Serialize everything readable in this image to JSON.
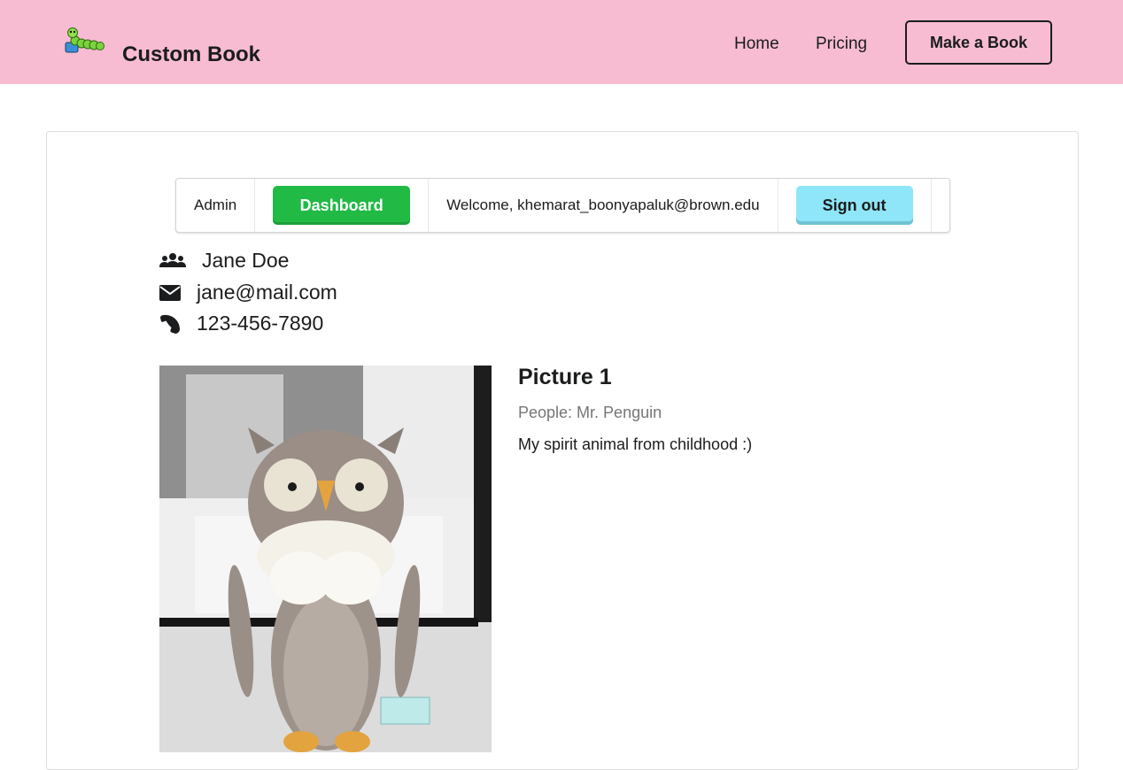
{
  "header": {
    "brand": "Custom Book",
    "logo_icon": "caterpillar-logo",
    "nav": {
      "home": "Home",
      "pricing": "Pricing",
      "make_book": "Make a Book"
    },
    "background_color": "#f7bcd1"
  },
  "admin_menu": {
    "admin_label": "Admin",
    "dashboard_label": "Dashboard",
    "welcome_text": "Welcome, khemarat_boonyapaluk@brown.edu",
    "signout_label": "Sign out",
    "dashboard_color": "#21ba45",
    "signout_color": "#8ee6f8"
  },
  "customer": {
    "name": "Jane Doe",
    "email": "jane@mail.com",
    "phone": "123-456-7890"
  },
  "pictures": [
    {
      "title": "Picture 1",
      "people": "People: Mr. Penguin",
      "description": "My spirit animal from childhood :)"
    }
  ]
}
